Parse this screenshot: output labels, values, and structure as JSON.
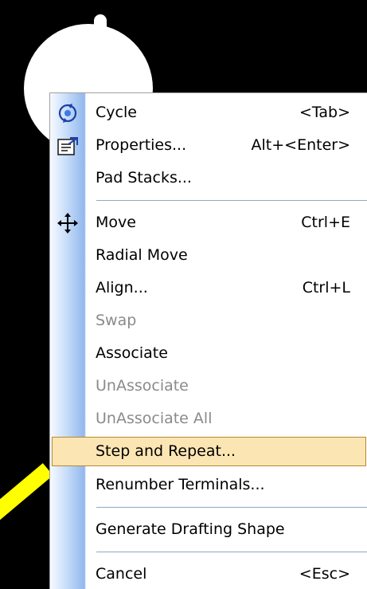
{
  "menu": {
    "items": [
      {
        "label": "Cycle",
        "shortcut": "<Tab>",
        "icon": "cycle-icon"
      },
      {
        "label": "Properties...",
        "shortcut": "Alt+<Enter>",
        "icon": "properties-icon"
      },
      {
        "label": "Pad Stacks...",
        "shortcut": ""
      },
      {
        "label": "Move",
        "shortcut": "Ctrl+E",
        "icon": "move-icon"
      },
      {
        "label": "Radial Move",
        "shortcut": ""
      },
      {
        "label": "Align...",
        "shortcut": "Ctrl+L"
      },
      {
        "label": "Swap",
        "shortcut": "",
        "disabled": true
      },
      {
        "label": "Associate",
        "shortcut": ""
      },
      {
        "label": "UnAssociate",
        "shortcut": "",
        "disabled": true
      },
      {
        "label": "UnAssociate All",
        "shortcut": "",
        "disabled": true
      },
      {
        "label": "Step and Repeat...",
        "shortcut": "",
        "highlighted": true
      },
      {
        "label": "Renumber Terminals...",
        "shortcut": ""
      },
      {
        "label": "Generate Drafting Shape",
        "shortcut": ""
      },
      {
        "label": "Cancel",
        "shortcut": "<Esc>"
      }
    ]
  },
  "colors": {
    "canvas": "#000000",
    "pad": "#ffffff",
    "trace": "#ffff00",
    "highlight_fill": "#fbe5b3",
    "highlight_border": "#b88a2e",
    "disabled_text": "#8a8a8a"
  }
}
